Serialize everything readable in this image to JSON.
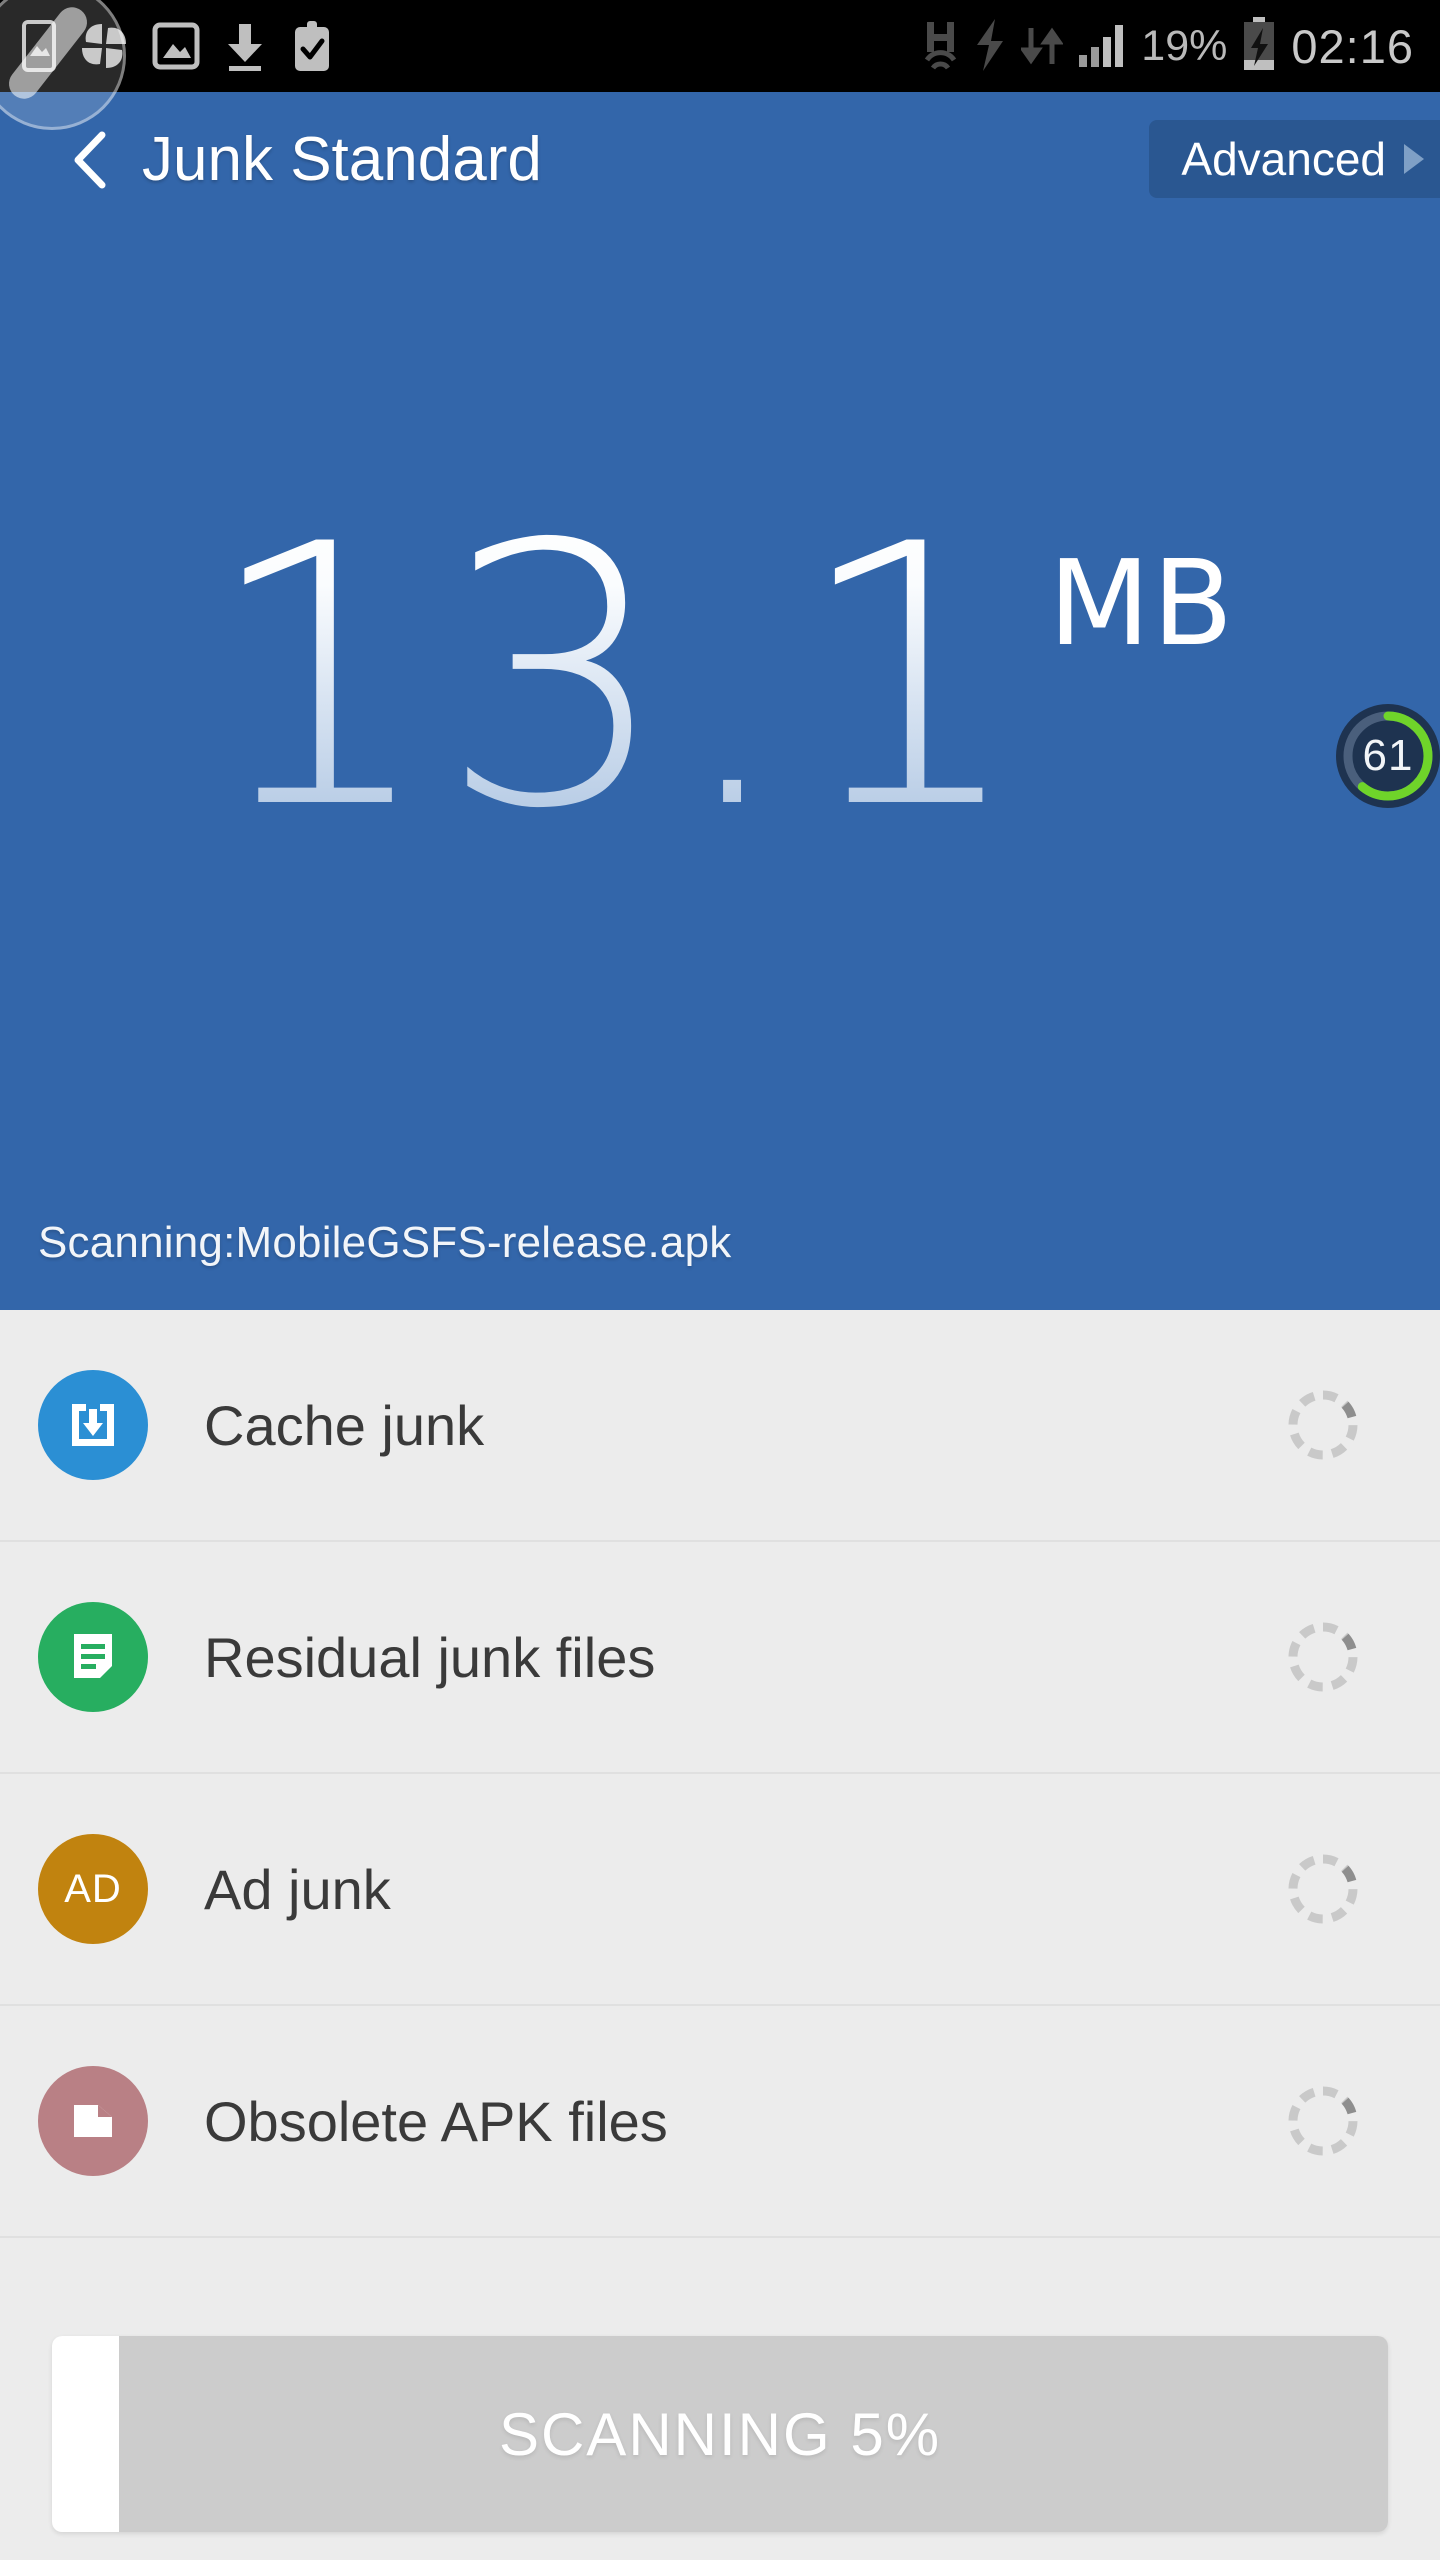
{
  "statusbar": {
    "left_icons": [
      {
        "name": "screenshot-icon",
        "glyph": "image-in-phone"
      },
      {
        "name": "pinwheel-icon",
        "glyph": "pinwheel"
      },
      {
        "name": "gallery-icon",
        "glyph": "picture"
      },
      {
        "name": "download-icon",
        "glyph": "download-arrow"
      },
      {
        "name": "clipboard-check-icon",
        "glyph": "clipboard-check"
      }
    ],
    "right_icons": [
      {
        "name": "hspa-icon",
        "glyph": "H"
      },
      {
        "name": "flash-icon",
        "glyph": "bolt"
      },
      {
        "name": "wifi-icon",
        "glyph": "wifi"
      },
      {
        "name": "data-transfer-icon",
        "glyph": "up-down-arrows"
      },
      {
        "name": "signal-icon",
        "glyph": "signal-bars"
      }
    ],
    "battery_percent": "19%",
    "battery_state": "charging",
    "time": "02:16"
  },
  "appbar": {
    "back_label": "back",
    "title": "Junk Standard",
    "advanced_label": "Advanced"
  },
  "hero": {
    "size_value": "13.1",
    "size_unit": "MB",
    "scanning_text": "Scanning:MobileGSFS-release.apk",
    "score_value": "61",
    "score_percent": 61,
    "background_color": "#3366AA",
    "score_ring_color": "#6FD42A",
    "score_bg_color": "#1E3350"
  },
  "junk_list": [
    {
      "label": "Cache junk",
      "icon_name": "cache-download-icon",
      "icon_color": "#2B8FD4",
      "status": "scanning"
    },
    {
      "label": "Residual junk files",
      "icon_name": "document-lines-icon",
      "icon_color": "#27AE60",
      "status": "scanning"
    },
    {
      "label": "Ad junk",
      "icon_name": "ad-icon",
      "icon_color": "#C1830F",
      "icon_text": "AD",
      "status": "scanning"
    },
    {
      "label": "Obsolete APK files",
      "icon_name": "folder-icon",
      "icon_color": "#B98085",
      "status": "scanning"
    }
  ],
  "scan_button": {
    "label": "SCANNING 5%",
    "progress_percent": 5,
    "fill_color": "#FFFFFF",
    "track_color": "#CCCCCC"
  },
  "float_overlay": {
    "name": "screen-recorder-bubble"
  }
}
